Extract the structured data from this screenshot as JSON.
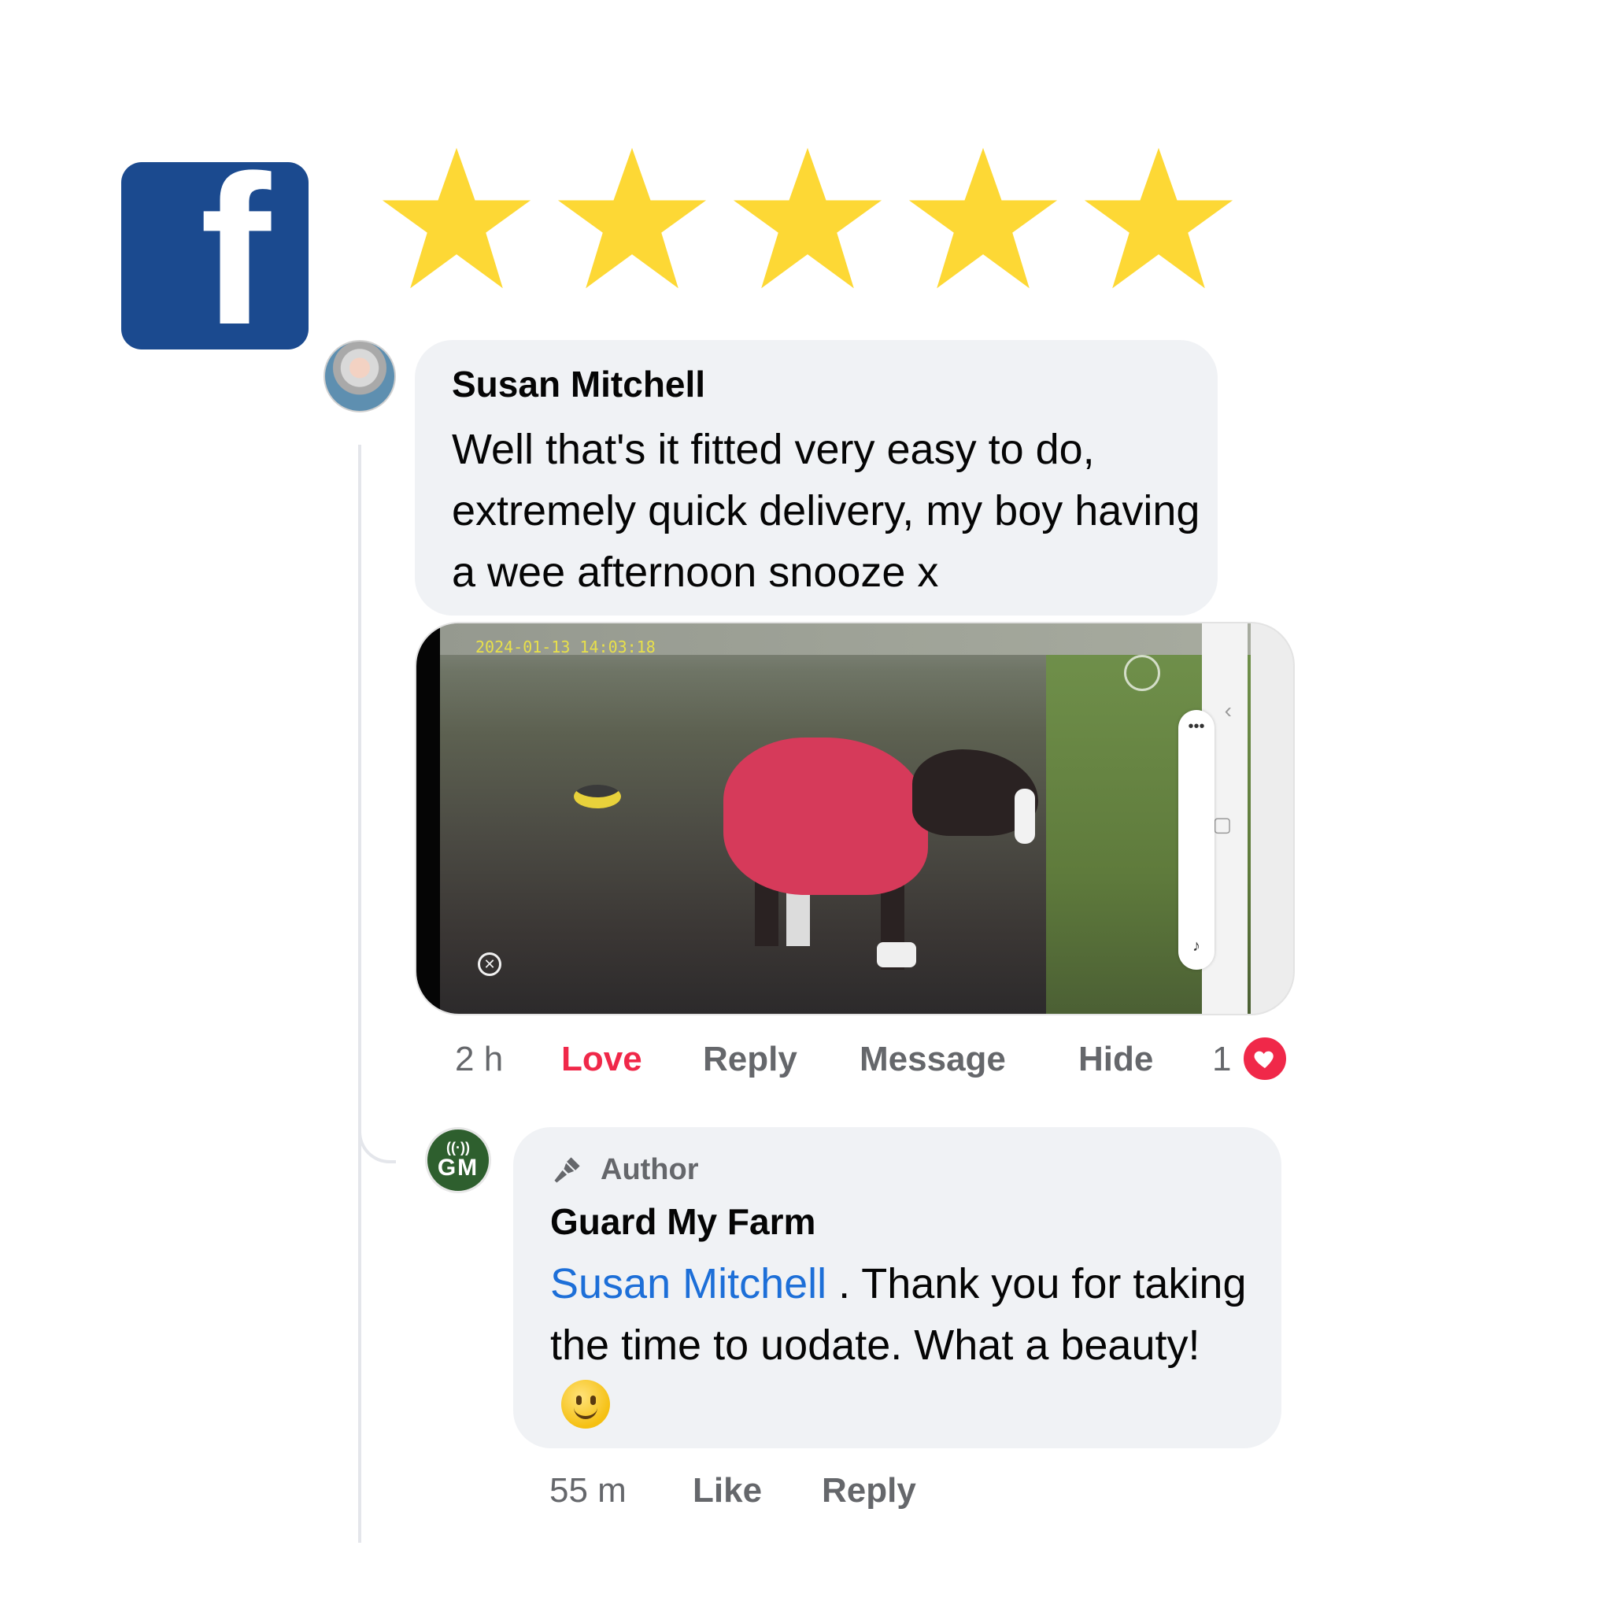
{
  "logo": {
    "icon": "facebook-icon",
    "letter": "f",
    "color": "#1b4a8f"
  },
  "rating": {
    "stars": 5,
    "max": 5,
    "color": "#fdd835"
  },
  "comment": {
    "author": "Susan Mitchell",
    "text": "Well that's it fitted very easy to do, extremely quick delivery, my boy having a wee afternoon snooze x",
    "photo": {
      "timestamp": "2024-01-13 14:03:18"
    },
    "actions": {
      "time": "2 h",
      "love": "Love",
      "reply": "Reply",
      "message": "Message",
      "hide": "Hide",
      "reaction_count": "1",
      "reaction": "heart-icon"
    }
  },
  "reply": {
    "badge": "Author",
    "author": "Guard My Farm",
    "avatar_text": "GM",
    "mention": "Susan Mitchell",
    "text": " . Thank you for taking the time to uodate. What a beauty!",
    "emoji": "slightly-smiling-face-icon",
    "actions": {
      "time": "55 m",
      "like": "Like",
      "reply": "Reply"
    }
  },
  "colors": {
    "bubble": "#f0f2f5",
    "love": "#f02849",
    "mention": "#1d6fd8",
    "secondary_text": "#65676b"
  }
}
